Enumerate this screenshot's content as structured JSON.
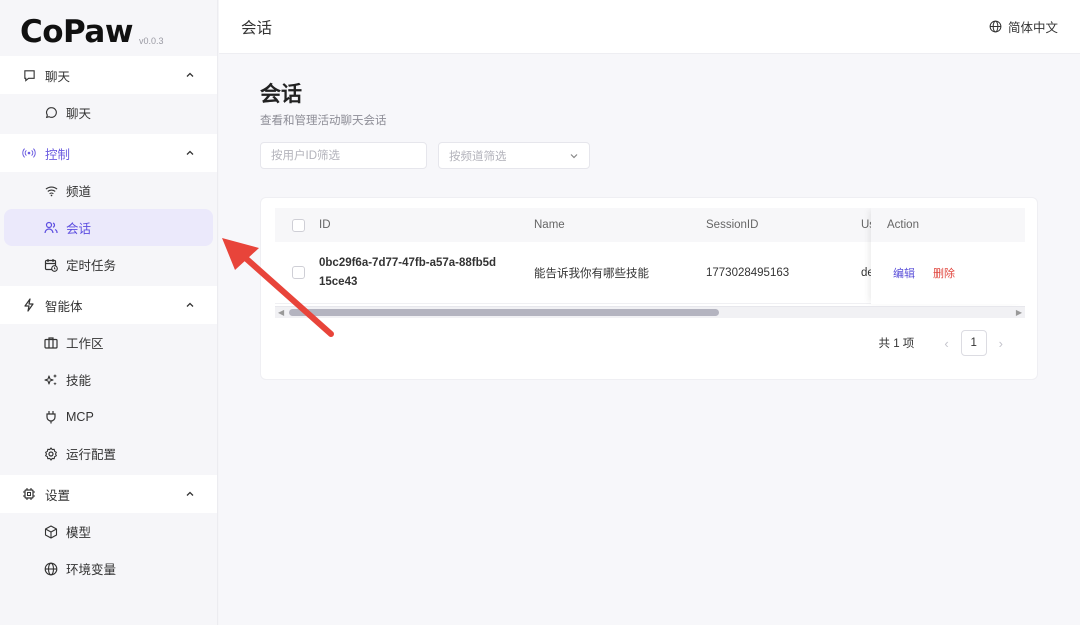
{
  "app": {
    "logo": "CoPaw",
    "version": "v0.0.3"
  },
  "sidebar": {
    "groups": [
      {
        "label": "聊天",
        "icon": "chat-bubble-icon",
        "items": [
          {
            "label": "聊天",
            "icon": "chat-circle-icon"
          }
        ]
      },
      {
        "label": "控制",
        "icon": "broadcast-icon",
        "items": [
          {
            "label": "频道",
            "icon": "wifi-icon"
          },
          {
            "label": "会话",
            "icon": "users-icon",
            "selected": true
          },
          {
            "label": "定时任务",
            "icon": "calendar-clock-icon"
          }
        ]
      },
      {
        "label": "智能体",
        "icon": "lightning-icon",
        "items": [
          {
            "label": "工作区",
            "icon": "briefcase-icon"
          },
          {
            "label": "技能",
            "icon": "sparkles-icon"
          },
          {
            "label": "MCP",
            "icon": "plug-icon"
          },
          {
            "label": "运行配置",
            "icon": "gear-icon"
          }
        ]
      },
      {
        "label": "设置",
        "icon": "chip-icon",
        "items": [
          {
            "label": "模型",
            "icon": "cube-icon"
          },
          {
            "label": "环境变量",
            "icon": "globe-icon"
          }
        ]
      }
    ]
  },
  "topbar": {
    "title": "会话",
    "language": "简体中文"
  },
  "page": {
    "title": "会话",
    "subtitle": "查看和管理活动聊天会话",
    "filter_user_placeholder": "按用户ID筛选",
    "filter_channel_placeholder": "按频道筛选"
  },
  "table": {
    "columns": {
      "id": "ID",
      "name": "Name",
      "session_id": "SessionID",
      "user": "Us",
      "action": "Action"
    },
    "rows": [
      {
        "id": "0bc29f6a-7d77-47fb-a57a-88fb5d15ce43",
        "name": "能告诉我你有哪些技能",
        "session_id": "1773028495163",
        "user": "de",
        "edit": "编辑",
        "delete": "删除"
      }
    ]
  },
  "pagination": {
    "total": "共 1 项",
    "current": "1"
  },
  "colors": {
    "accent": "#5d4ee0",
    "danger": "#e0453d",
    "annotation": "#e8443a"
  }
}
